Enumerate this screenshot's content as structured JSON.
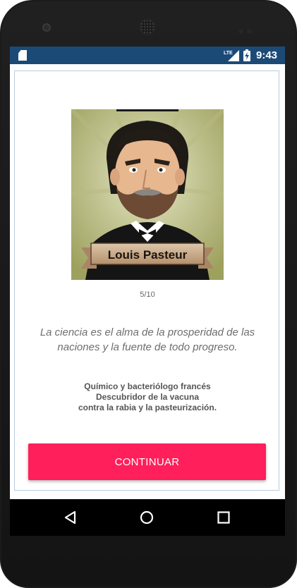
{
  "status_bar": {
    "time": "9:43",
    "network": "LTE",
    "icons": [
      "sd-card-icon",
      "lte-signal-icon",
      "battery-charging-icon"
    ]
  },
  "portrait": {
    "banner_name": "Louis Pasteur",
    "colors": {
      "background": "#a9ad6a",
      "banner": "#c9a98a"
    }
  },
  "main": {
    "page_counter": "5/10",
    "quote": "La ciencia es el alma de la prosperidad de las naciones y la fuente de todo progreso.",
    "bio_lines": [
      "Químico y bacteriólogo francés",
      "Descubridor de la vacuna",
      "contra la rabia y la pasteurización."
    ],
    "continue_label": "CONTINUAR"
  },
  "nav_bar": {
    "icons": [
      "back-icon",
      "home-icon",
      "recent-apps-icon"
    ]
  },
  "colors": {
    "status_bar": "#1c4a77",
    "accent_button": "#ff1f5a",
    "frame_border": "#b9cde0"
  }
}
